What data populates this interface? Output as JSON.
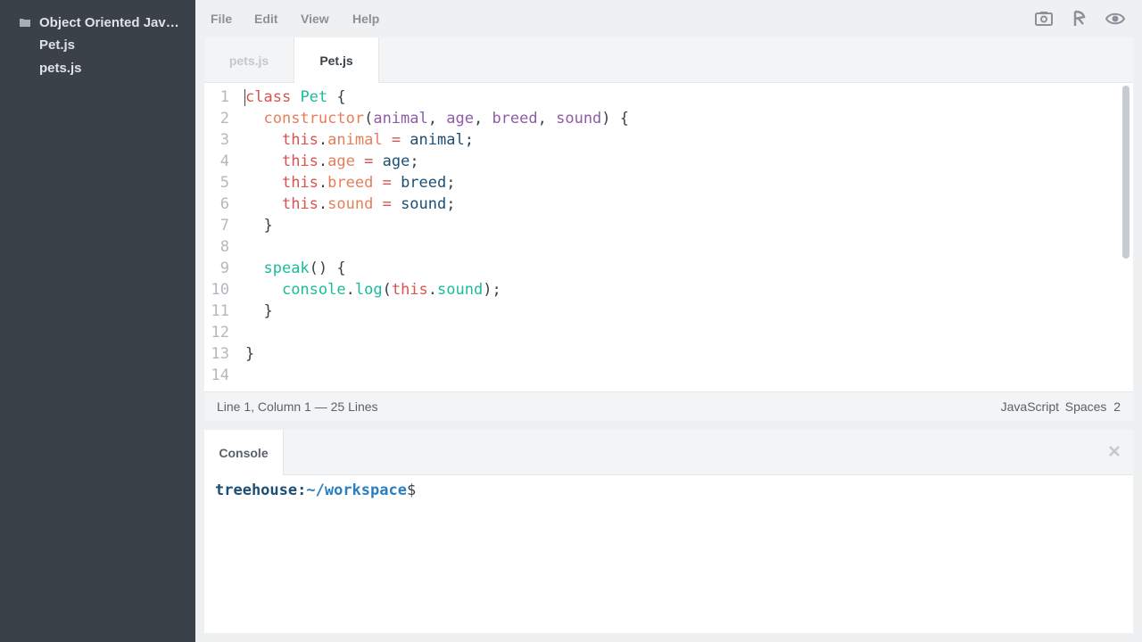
{
  "sidebar": {
    "folder_title": "Object Oriented Jav…",
    "files": [
      "Pet.js",
      "pets.js"
    ]
  },
  "menu": {
    "items": [
      "File",
      "Edit",
      "View",
      "Help"
    ],
    "icons": [
      "camera-icon",
      "share-icon",
      "preview-eye-icon"
    ]
  },
  "editor": {
    "tabs": [
      {
        "label": "pets.js",
        "active": false
      },
      {
        "label": "Pet.js",
        "active": true
      }
    ],
    "lines": [
      {
        "n": "1",
        "tokens": [
          [
            "class",
            "#d9534f"
          ],
          [
            " ",
            ""
          ],
          [
            "Pet",
            "#1abc9c"
          ],
          [
            " {",
            ""
          ]
        ]
      },
      {
        "n": "2",
        "tokens": [
          [
            "  ",
            ""
          ],
          [
            "constructor",
            "#e67e5a"
          ],
          [
            "(",
            ""
          ],
          [
            "animal",
            "#8e5ca8"
          ],
          [
            ", ",
            ""
          ],
          [
            "age",
            "#8e5ca8"
          ],
          [
            ", ",
            ""
          ],
          [
            "breed",
            "#8e5ca8"
          ],
          [
            ", ",
            ""
          ],
          [
            "sound",
            "#8e5ca8"
          ],
          [
            ") {",
            ""
          ]
        ]
      },
      {
        "n": "3",
        "tokens": [
          [
            "    ",
            ""
          ],
          [
            "this",
            "#d9534f"
          ],
          [
            ".",
            ""
          ],
          [
            "animal",
            "#e67e5a"
          ],
          [
            " = ",
            "#d9534f"
          ],
          [
            "animal",
            "#1c4f75"
          ],
          [
            ";",
            ""
          ]
        ]
      },
      {
        "n": "4",
        "tokens": [
          [
            "    ",
            ""
          ],
          [
            "this",
            "#d9534f"
          ],
          [
            ".",
            ""
          ],
          [
            "age",
            "#e67e5a"
          ],
          [
            " = ",
            "#d9534f"
          ],
          [
            "age",
            "#1c4f75"
          ],
          [
            ";",
            ""
          ]
        ]
      },
      {
        "n": "5",
        "tokens": [
          [
            "    ",
            ""
          ],
          [
            "this",
            "#d9534f"
          ],
          [
            ".",
            ""
          ],
          [
            "breed",
            "#e67e5a"
          ],
          [
            " = ",
            "#d9534f"
          ],
          [
            "breed",
            "#1c4f75"
          ],
          [
            ";",
            ""
          ]
        ]
      },
      {
        "n": "6",
        "tokens": [
          [
            "    ",
            ""
          ],
          [
            "this",
            "#d9534f"
          ],
          [
            ".",
            ""
          ],
          [
            "sound",
            "#e67e5a"
          ],
          [
            " = ",
            "#d9534f"
          ],
          [
            "sound",
            "#1c4f75"
          ],
          [
            ";",
            ""
          ]
        ]
      },
      {
        "n": "7",
        "tokens": [
          [
            "  }",
            ""
          ]
        ]
      },
      {
        "n": "8",
        "tokens": [
          [
            "",
            ""
          ]
        ]
      },
      {
        "n": "9",
        "tokens": [
          [
            "  ",
            ""
          ],
          [
            "speak",
            "#1abc9c"
          ],
          [
            "() {",
            ""
          ]
        ]
      },
      {
        "n": "10",
        "tokens": [
          [
            "    ",
            ""
          ],
          [
            "console",
            "#1abc9c"
          ],
          [
            ".",
            ""
          ],
          [
            "log",
            "#1abc9c"
          ],
          [
            "(",
            ""
          ],
          [
            "this",
            "#d9534f"
          ],
          [
            ".",
            ""
          ],
          [
            "sound",
            "#1abc9c"
          ],
          [
            ");",
            ""
          ]
        ]
      },
      {
        "n": "11",
        "tokens": [
          [
            "  }",
            ""
          ]
        ]
      },
      {
        "n": "12",
        "tokens": [
          [
            "",
            ""
          ]
        ]
      },
      {
        "n": "13",
        "tokens": [
          [
            "}",
            ""
          ]
        ]
      },
      {
        "n": "14",
        "tokens": [
          [
            "",
            ""
          ]
        ]
      }
    ],
    "status": {
      "position": "Line 1, Column 1 — 25 Lines",
      "language": "JavaScript",
      "indent": "Spaces  2"
    }
  },
  "console": {
    "tab_label": "Console",
    "prompt_host": "treehouse",
    "prompt_sep": ":",
    "prompt_path": "~/workspace",
    "prompt_symbol": "$"
  },
  "colors": {
    "sidebar_bg": "#3a4148",
    "keyword": "#d9534f",
    "function": "#1abc9c",
    "param": "#8e5ca8",
    "property": "#e67e5a",
    "variable": "#1c4f75",
    "prompt_host": "#1c4f75",
    "prompt_path": "#2a7fc1"
  }
}
